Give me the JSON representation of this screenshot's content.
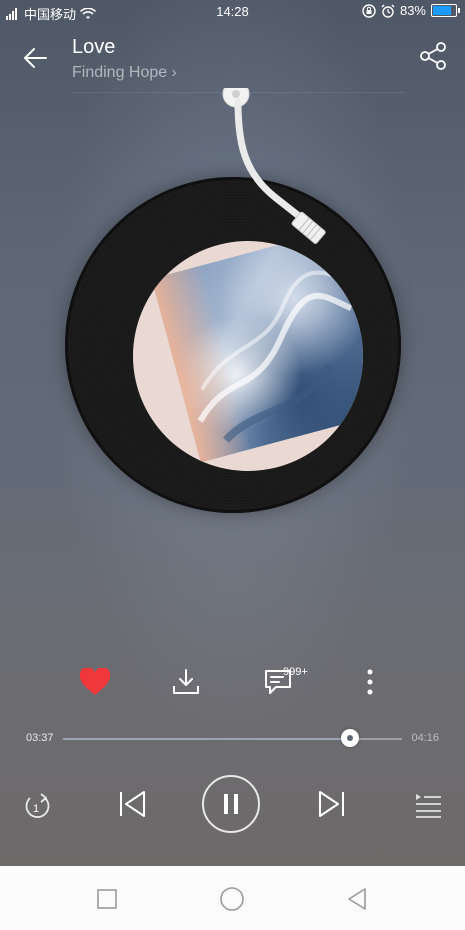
{
  "status_bar": {
    "carrier": "中国移动",
    "time": "14:28",
    "battery": "83%",
    "battery_level": 0.83
  },
  "header": {
    "title": "Love",
    "subtitle": "Finding Hope",
    "back_icon": "arrow-left-icon",
    "share_icon": "share-icon"
  },
  "actions": {
    "like_icon": "heart-icon",
    "download_icon": "download-icon",
    "comments_icon": "comment-icon",
    "comments_count": "999+",
    "more_icon": "more-vertical-icon"
  },
  "progress": {
    "current": "03:37",
    "total": "04:16",
    "fraction": 0.848
  },
  "controls": {
    "repeat_icon": "repeat-one-icon",
    "prev_icon": "skip-previous-icon",
    "play_pause_icon": "pause-icon",
    "next_icon": "skip-next-icon",
    "playlist_icon": "playlist-icon"
  },
  "navbar": {
    "recents_icon": "square-icon",
    "home_icon": "circle-icon",
    "back_icon": "triangle-back-icon"
  },
  "colors": {
    "heart": "#f0373c",
    "accent_battery": "#1e9bff",
    "text": "#ffffff"
  }
}
